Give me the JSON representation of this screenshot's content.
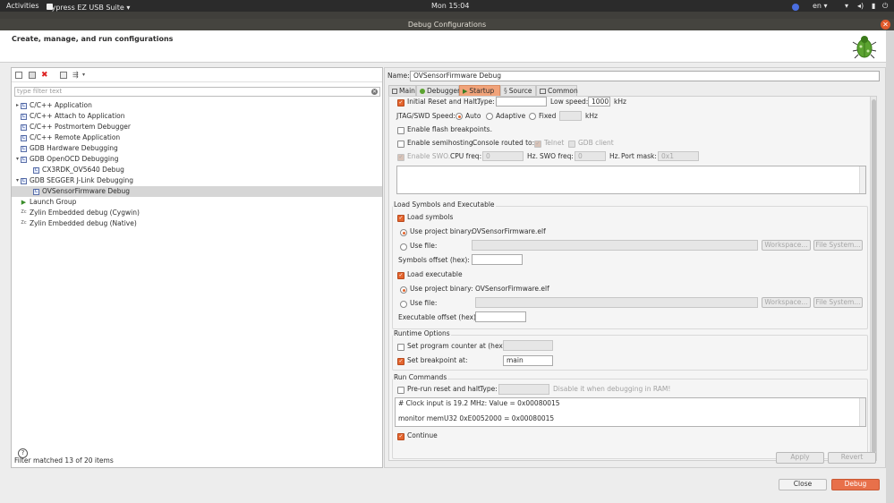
{
  "topbar": {
    "activities": "Activities",
    "app_menu": "Cypress EZ USB Suite ▾",
    "clock": "Mon 15:04",
    "lang": "en ▾"
  },
  "dialog": {
    "title": "Debug Configurations",
    "header": "Create, manage, and run configurations"
  },
  "left": {
    "filter_placeholder": "type filter text",
    "filter_status": "Filter matched 13 of 20 items",
    "tree": [
      {
        "label": "C/C++ Application",
        "level": 0,
        "expand": "▸",
        "icon": "C"
      },
      {
        "label": "C/C++ Attach to Application",
        "level": 0,
        "expand": "",
        "icon": "C"
      },
      {
        "label": "C/C++ Postmortem Debugger",
        "level": 0,
        "expand": "",
        "icon": "C"
      },
      {
        "label": "C/C++ Remote Application",
        "level": 0,
        "expand": "",
        "icon": "C"
      },
      {
        "label": "GDB Hardware Debugging",
        "level": 0,
        "expand": "",
        "icon": "C"
      },
      {
        "label": "GDB OpenOCD Debugging",
        "level": 0,
        "expand": "▾",
        "icon": "C"
      },
      {
        "label": "CX3RDK_OV5640 Debug",
        "level": 1,
        "expand": "",
        "icon": "C"
      },
      {
        "label": "GDB SEGGER J-Link Debugging",
        "level": 0,
        "expand": "▾",
        "icon": "C"
      },
      {
        "label": "OVSensorFirmware Debug",
        "level": 1,
        "expand": "",
        "icon": "C",
        "selected": true
      },
      {
        "label": "Launch Group",
        "level": 0,
        "expand": "",
        "icon": "▶"
      },
      {
        "label": "Zylin Embedded debug (Cygwin)",
        "level": 0,
        "expand": "",
        "icon": "Zc"
      },
      {
        "label": "Zylin Embedded debug (Native)",
        "level": 0,
        "expand": "",
        "icon": "Zc"
      }
    ]
  },
  "right": {
    "name_label": "Name:",
    "name_value": "OVSensorFirmware Debug",
    "tabs": [
      "Main",
      "Debugger",
      "Startup",
      "Source",
      "Common"
    ],
    "active_tab": "Startup",
    "init": {
      "initial_reset": "Initial Reset and Halt.",
      "type_label": "Type:",
      "low_speed_label": "Low speed:",
      "low_speed_value": "1000",
      "khz": "kHz",
      "jtag_label": "JTAG/SWD Speed:",
      "auto": "Auto",
      "adaptive": "Adaptive",
      "fixed": "Fixed",
      "fixed_khz": "kHz",
      "flash_bp": "Enable flash breakpoints.",
      "semihosting": "Enable semihosting.",
      "console_routed": "Console routed to:",
      "telnet": "Telnet",
      "gdb_client": "GDB client",
      "enable_swo": "Enable SWO.",
      "cpu_freq": "CPU freq:",
      "cpu_freq_value": "0",
      "hz1": "Hz.",
      "swo_freq": "SWO freq:",
      "swo_freq_value": "0",
      "hz2": "Hz.",
      "port_mask": "Port mask:",
      "port_mask_value": "0x1"
    },
    "load": {
      "title": "Load Symbols and Executable",
      "load_symbols": "Load symbols",
      "use_project_binary": "Use project binary:",
      "symbols_binary": "OVSensorFirmware.elf",
      "use_file": "Use file:",
      "workspace": "Workspace...",
      "file_system": "File System...",
      "symbols_offset": "Symbols offset (hex):",
      "load_executable": "Load executable",
      "exec_binary": "OVSensorFirmware.elf",
      "exec_offset": "Executable offset (hex):"
    },
    "runtime": {
      "title": "Runtime Options",
      "set_pc": "Set program counter at (hex):",
      "set_bp": "Set breakpoint at:",
      "bp_value": "main"
    },
    "run": {
      "title": "Run Commands",
      "pre_run": "Pre-run reset and halt.",
      "type_label": "Type:",
      "disable_hint": "Disable it when debugging in RAM!",
      "line1": "# Clock input is 19.2 MHz: Value = 0x00080015",
      "line2": "monitor memU32 0xE0052000 = 0x00080015",
      "continue": "Continue"
    },
    "apply": "Apply",
    "revert": "Revert"
  },
  "footer": {
    "close": "Close",
    "debug": "Debug",
    "help": "?"
  }
}
